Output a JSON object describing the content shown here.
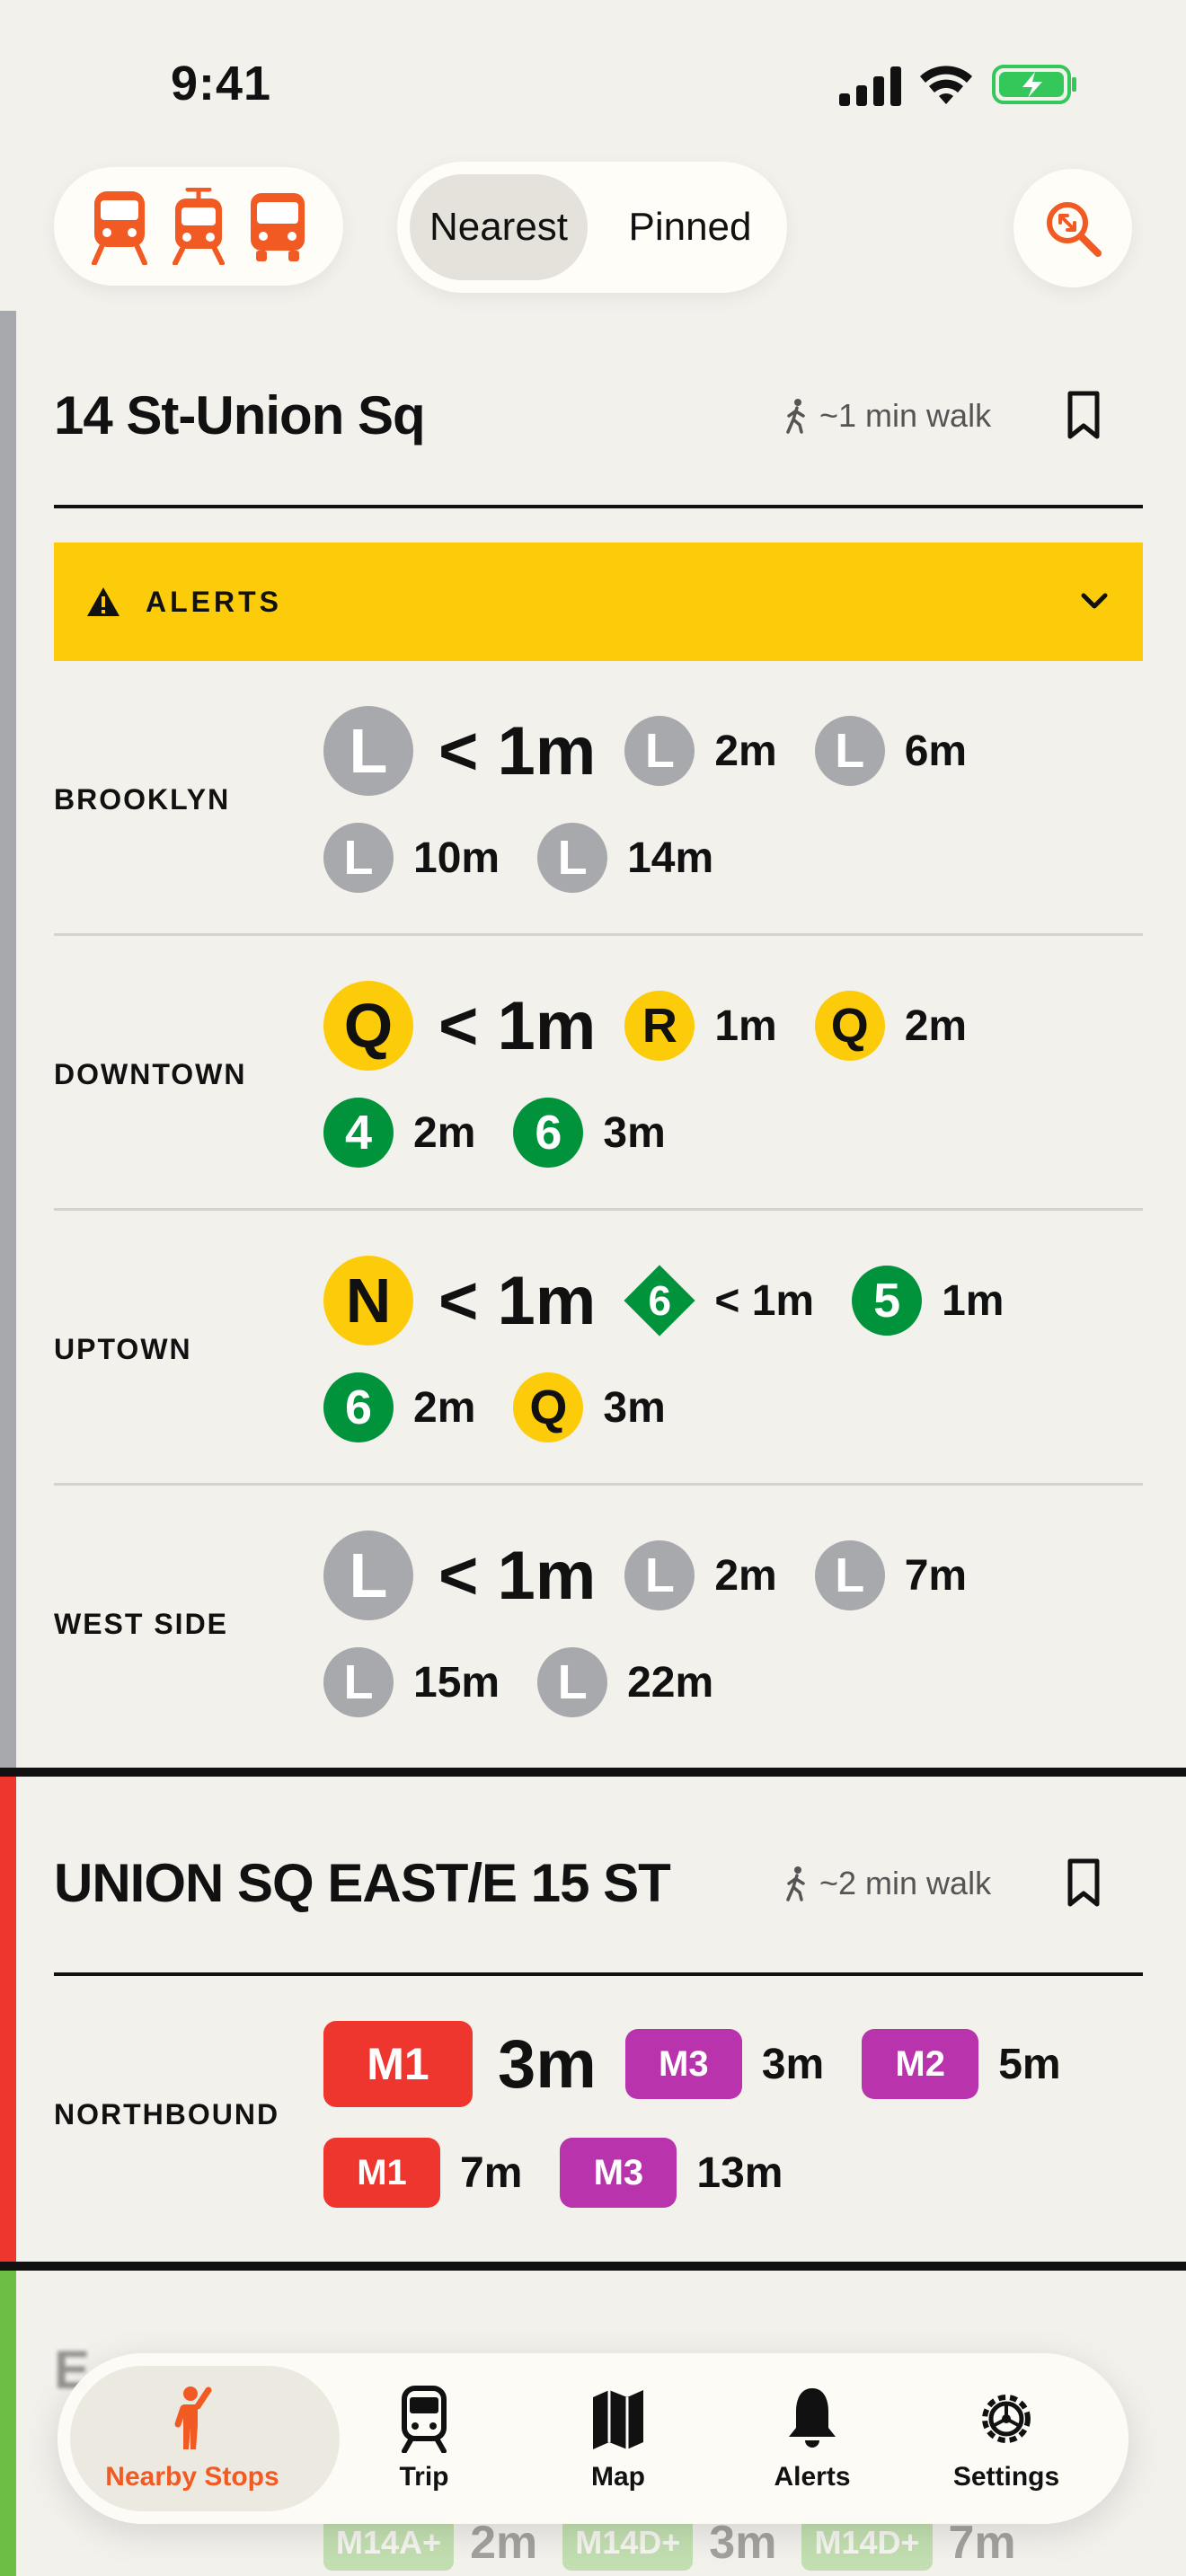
{
  "status_bar": {
    "time": "9:41"
  },
  "top_controls": {
    "segments": [
      "Nearest",
      "Pinned"
    ],
    "selected_segment": "Nearest",
    "mode_icons": [
      "subway-icon",
      "tram-icon",
      "bus-icon"
    ],
    "accent_color": "#f15a22"
  },
  "stops": [
    {
      "name": "14 St-Union Sq",
      "walk": "~1 min walk",
      "side_color": "#a7a9ac",
      "alerts_label": "ALERTS",
      "directions": [
        {
          "label": "BROOKLYN",
          "row1": [
            {
              "route": "L",
              "time": "< 1m"
            },
            {
              "route": "L",
              "time": "2m"
            },
            {
              "route": "L",
              "time": "6m"
            }
          ],
          "row2": [
            {
              "route": "L",
              "time": "10m"
            },
            {
              "route": "L",
              "time": "14m"
            }
          ]
        },
        {
          "label": "DOWNTOWN",
          "row1": [
            {
              "route": "Q",
              "time": "< 1m"
            },
            {
              "route": "R",
              "time": "1m"
            },
            {
              "route": "Q",
              "time": "2m"
            }
          ],
          "row2": [
            {
              "route": "4",
              "time": "2m"
            },
            {
              "route": "6",
              "time": "3m"
            }
          ]
        },
        {
          "label": "UPTOWN",
          "row1": [
            {
              "route": "N",
              "time": "< 1m"
            },
            {
              "route": "6",
              "time": "< 1m",
              "express": true
            },
            {
              "route": "5",
              "time": "1m"
            }
          ],
          "row2": [
            {
              "route": "6",
              "time": "2m"
            },
            {
              "route": "Q",
              "time": "3m"
            }
          ]
        },
        {
          "label": "WEST SIDE",
          "row1": [
            {
              "route": "L",
              "time": "< 1m"
            },
            {
              "route": "L",
              "time": "2m"
            },
            {
              "route": "L",
              "time": "7m"
            }
          ],
          "row2": [
            {
              "route": "L",
              "time": "15m"
            },
            {
              "route": "L",
              "time": "22m"
            }
          ]
        }
      ]
    },
    {
      "name": "UNION SQ EAST/E 15 ST",
      "walk": "~2 min walk",
      "side_color": "#ee352e",
      "directions": [
        {
          "label": "NORTHBOUND",
          "row1": [
            {
              "route": "M1",
              "time": "3m"
            },
            {
              "route": "M3",
              "time": "3m"
            },
            {
              "route": "M2",
              "time": "5m"
            }
          ],
          "row2": [
            {
              "route": "M1",
              "time": "7m"
            },
            {
              "route": "M3",
              "time": "13m"
            }
          ]
        }
      ]
    },
    {
      "name": "E",
      "side_color": "#6cbe45",
      "partial_row": [
        {
          "route": "M14A+",
          "time": "2m"
        },
        {
          "route": "M14D+",
          "time": "3m"
        },
        {
          "route": "M14D+",
          "time": "7m"
        }
      ]
    }
  ],
  "tab_bar": {
    "items": [
      {
        "label": "Nearby Stops",
        "icon": "person-icon"
      },
      {
        "label": "Trip",
        "icon": "train-icon"
      },
      {
        "label": "Map",
        "icon": "map-icon"
      },
      {
        "label": "Alerts",
        "icon": "bell-icon"
      },
      {
        "label": "Settings",
        "icon": "gear-icon"
      }
    ],
    "selected": "Nearby Stops"
  },
  "colors": {
    "L": "#a7a9ac",
    "NQR": "#fccc0a",
    "456": "#00933c",
    "M1": "#ee352e",
    "M2_M3": "#b933ad",
    "alerts_bg": "#fccc0a"
  }
}
